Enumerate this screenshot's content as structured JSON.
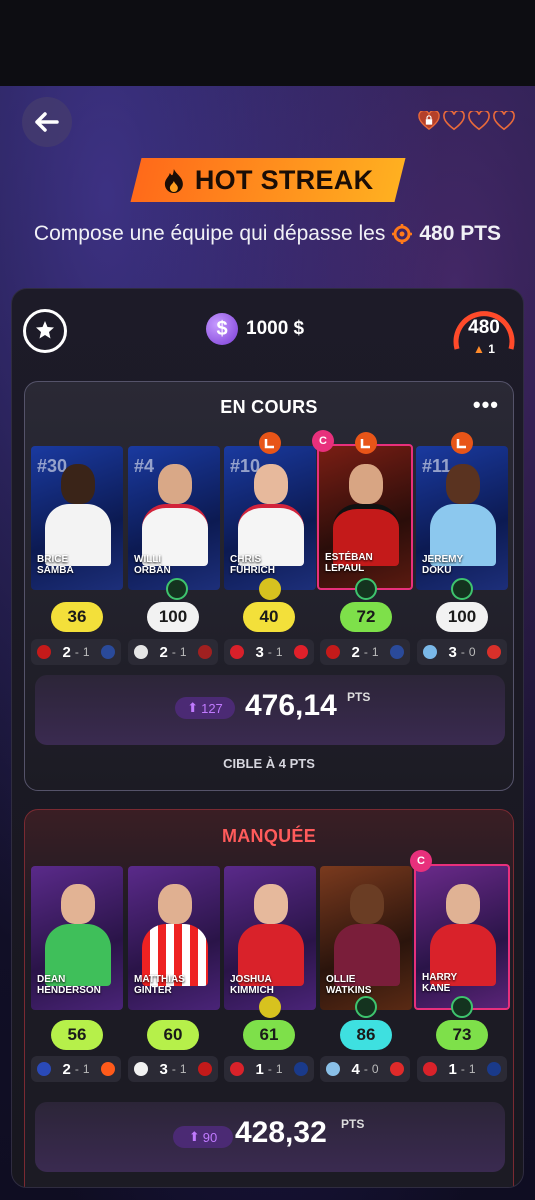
{
  "header": {
    "title": "HOT STREAK",
    "subtitle": "Compose une équipe qui dépasse les",
    "subtitle_pts": "480 PTS",
    "lives_total": 4,
    "lives_filled": 1
  },
  "panel": {
    "coins": "1000 $",
    "coin_symbol": "$",
    "gauge_value": "480",
    "gauge_streak": "1"
  },
  "sections": [
    {
      "title": "EN COURS",
      "more_label": "•••",
      "cards": [
        {
          "name1": "BRICE",
          "name2": "SAMBA",
          "jersey": "#30",
          "score": "36",
          "home": "2",
          "away": "1"
        },
        {
          "name1": "WILLI",
          "name2": "ORBÁN",
          "jersey": "#4",
          "score": "100",
          "home": "2",
          "away": "1"
        },
        {
          "name1": "CHRIS",
          "name2": "FÜHRICH",
          "jersey": "#10",
          "score": "40",
          "home": "3",
          "away": "1"
        },
        {
          "name1": "ESTÉBAN",
          "name2": "LEPAUL",
          "jersey": "",
          "score": "72",
          "home": "2",
          "away": "1",
          "captain": "C"
        },
        {
          "name1": "JEREMY",
          "name2": "DOKU",
          "jersey": "#11",
          "score": "100",
          "home": "3",
          "away": "0"
        }
      ],
      "bonus": "127",
      "total": "476,14",
      "total_unit": "PTS",
      "target": "CIBLE À 4 PTS"
    },
    {
      "title": "MANQUÉE",
      "cards": [
        {
          "name1": "DEAN",
          "name2": "HENDERSON",
          "score": "56",
          "home": "2",
          "away": "1"
        },
        {
          "name1": "MATTHIAS",
          "name2": "GINTER",
          "score": "60",
          "home": "3",
          "away": "1"
        },
        {
          "name1": "JOSHUA",
          "name2": "KIMMICH",
          "score": "61",
          "home": "1",
          "away": "1"
        },
        {
          "name1": "OLLIE",
          "name2": "WATKINS",
          "score": "86",
          "home": "4",
          "away": "0"
        },
        {
          "name1": "HARRY",
          "name2": "KANE",
          "score": "73",
          "home": "1",
          "away": "1",
          "captain": "C"
        }
      ],
      "bonus": "90",
      "total": "428,32",
      "total_unit": "PTS"
    }
  ],
  "colors": {
    "accent_orange": "#ff7a1a",
    "score_yellow": "#f3e03a",
    "score_green": "#7ee04a",
    "score_white": "#f2f2f2",
    "score_cyan": "#3ee0e0",
    "missed_red": "#ff5b5b",
    "captain_pink": "#e8307c"
  }
}
